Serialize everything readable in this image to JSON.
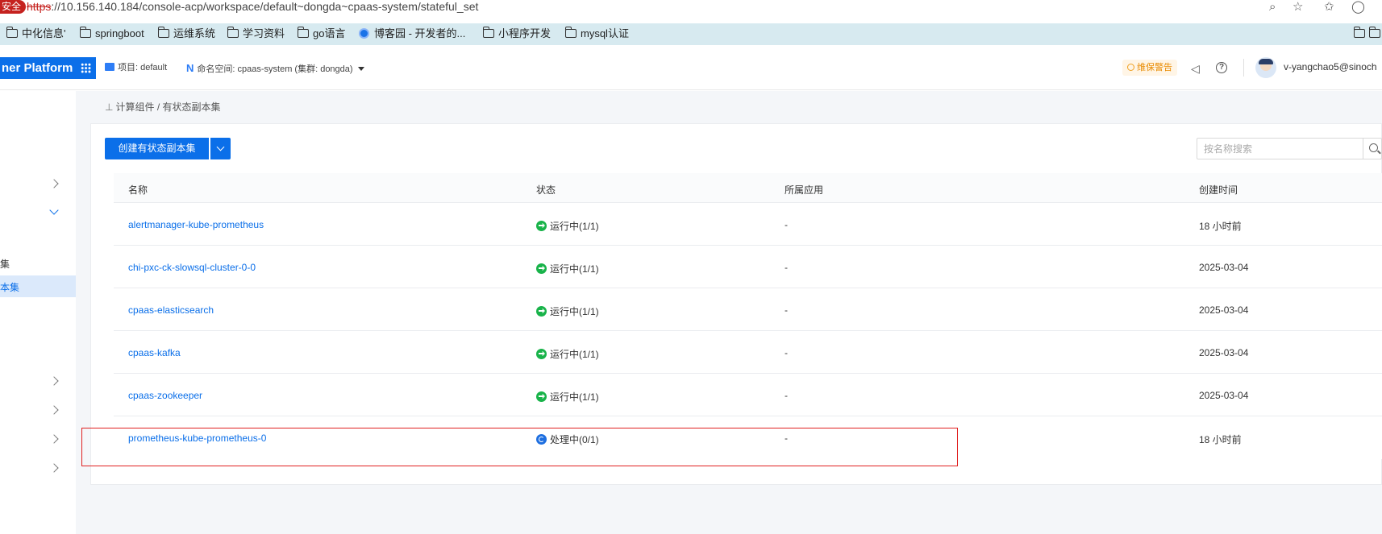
{
  "browser": {
    "insecure_label": "安全",
    "url_proto": "https",
    "url_rest": "://10.156.140.184/console-acp/workspace/default~dongda~cpaas-system/stateful_set",
    "icons": [
      "zoom-icon",
      "star-icon",
      "favorites-icon",
      "profile-icon"
    ]
  },
  "bookmarks": [
    {
      "label": "中化信息'",
      "icon": "folder-icon"
    },
    {
      "label": "springboot",
      "icon": "folder-icon"
    },
    {
      "label": "运维系统",
      "icon": "folder-icon"
    },
    {
      "label": "学习资料",
      "icon": "folder-icon"
    },
    {
      "label": "go语言",
      "icon": "folder-icon"
    },
    {
      "label": "博客园 - 开发者的...",
      "icon": "site-icon"
    },
    {
      "label": "小程序开发",
      "icon": "folder-icon"
    },
    {
      "label": "mysql认证",
      "icon": "folder-icon"
    }
  ],
  "header": {
    "brand": "ner Platform",
    "project_label": "项目:",
    "project_value": "default",
    "namespace_label": "命名空间:",
    "namespace_value": "cpaas-system (集群: dongda)",
    "warning": "维保警告",
    "user": "v-yangchao5@sinoch"
  },
  "sidebar": {
    "partial_label_1": "集",
    "active_label": "本集"
  },
  "breadcrumb": {
    "parent": "计算组件",
    "separator": "/",
    "current": "有状态副本集"
  },
  "toolbar": {
    "create_label": "创建有状态副本集",
    "search_placeholder": "按名称搜索"
  },
  "table": {
    "columns": [
      "名称",
      "状态",
      "所属应用",
      "创建时间"
    ],
    "rows": [
      {
        "name": "alertmanager-kube-prometheus",
        "status": "运行中(1/1)",
        "status_type": "running",
        "app": "-",
        "created": "18 小时前"
      },
      {
        "name": "chi-pxc-ck-slowsql-cluster-0-0",
        "status": "运行中(1/1)",
        "status_type": "running",
        "app": "-",
        "created": "2025-03-04"
      },
      {
        "name": "cpaas-elasticsearch",
        "status": "运行中(1/1)",
        "status_type": "running",
        "app": "-",
        "created": "2025-03-04"
      },
      {
        "name": "cpaas-kafka",
        "status": "运行中(1/1)",
        "status_type": "running",
        "app": "-",
        "created": "2025-03-04"
      },
      {
        "name": "cpaas-zookeeper",
        "status": "运行中(1/1)",
        "status_type": "running",
        "app": "-",
        "created": "2025-03-04"
      },
      {
        "name": "prometheus-kube-prometheus-0",
        "status": "处理中(0/1)",
        "status_type": "processing",
        "app": "-",
        "created": "18 小时前"
      }
    ]
  },
  "colors": {
    "accent": "#0b6fe9",
    "running": "#19b34a",
    "processing": "#1e6fe0",
    "highlight_box": "#e02020"
  }
}
